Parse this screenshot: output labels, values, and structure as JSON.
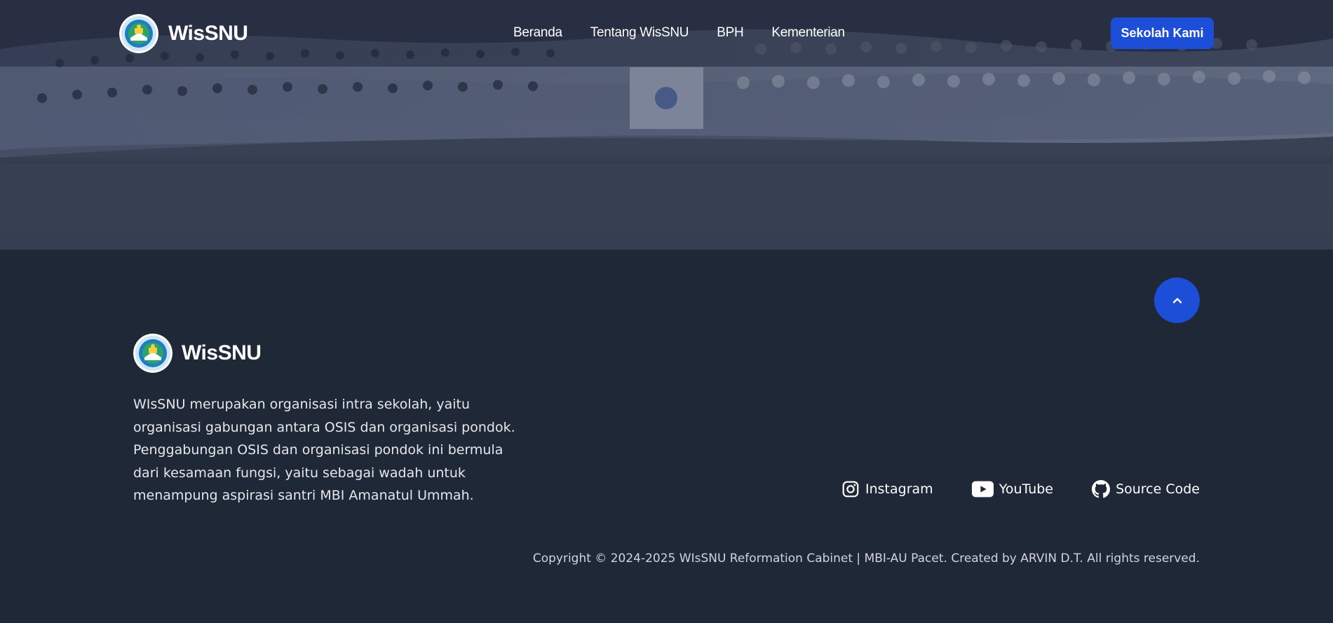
{
  "navbar": {
    "brand": "WisSNU",
    "links": [
      "Beranda",
      "Tentang WisSNU",
      "BPH",
      "Kementerian"
    ],
    "cta_label": "Sekolah Kami"
  },
  "footer": {
    "brand": "WisSNU",
    "description": "WIsSNU merupakan organisasi intra sekolah, yaitu organisasi gabungan antara OSIS dan organisasi pondok. Penggabungan OSIS dan organisasi pondok ini bermula dari kesamaan fungsi, yaitu sebagai wadah untuk menampung aspirasi santri MBI Amanatul Ummah.",
    "socials": [
      {
        "label": "Instagram",
        "icon": "instagram-icon"
      },
      {
        "label": "YouTube",
        "icon": "youtube-icon"
      },
      {
        "label": "Source Code",
        "icon": "github-icon"
      }
    ],
    "copyright": "Copyright © 2024-2025 WIsSNU Reformation Cabinet | MBI-AU Pacet. Created by ARVIN D.T. All rights reserved."
  },
  "colors": {
    "accent": "#1d4ed8",
    "footer_bg": "#1e2837"
  }
}
